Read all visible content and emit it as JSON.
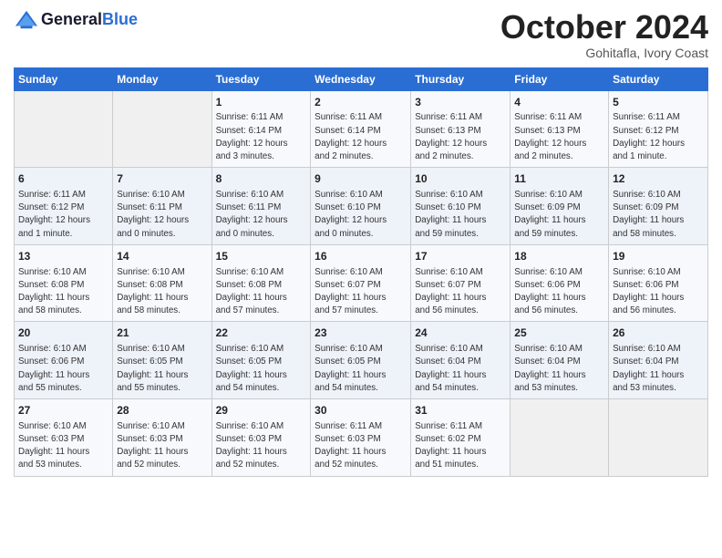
{
  "header": {
    "logo_general": "General",
    "logo_blue": "Blue",
    "month_title": "October 2024",
    "location": "Gohitafla, Ivory Coast"
  },
  "days_of_week": [
    "Sunday",
    "Monday",
    "Tuesday",
    "Wednesday",
    "Thursday",
    "Friday",
    "Saturday"
  ],
  "weeks": [
    [
      {
        "day": "",
        "info": ""
      },
      {
        "day": "",
        "info": ""
      },
      {
        "day": "1",
        "info": "Sunrise: 6:11 AM\nSunset: 6:14 PM\nDaylight: 12 hours\nand 3 minutes."
      },
      {
        "day": "2",
        "info": "Sunrise: 6:11 AM\nSunset: 6:14 PM\nDaylight: 12 hours\nand 2 minutes."
      },
      {
        "day": "3",
        "info": "Sunrise: 6:11 AM\nSunset: 6:13 PM\nDaylight: 12 hours\nand 2 minutes."
      },
      {
        "day": "4",
        "info": "Sunrise: 6:11 AM\nSunset: 6:13 PM\nDaylight: 12 hours\nand 2 minutes."
      },
      {
        "day": "5",
        "info": "Sunrise: 6:11 AM\nSunset: 6:12 PM\nDaylight: 12 hours\nand 1 minute."
      }
    ],
    [
      {
        "day": "6",
        "info": "Sunrise: 6:11 AM\nSunset: 6:12 PM\nDaylight: 12 hours\nand 1 minute."
      },
      {
        "day": "7",
        "info": "Sunrise: 6:10 AM\nSunset: 6:11 PM\nDaylight: 12 hours\nand 0 minutes."
      },
      {
        "day": "8",
        "info": "Sunrise: 6:10 AM\nSunset: 6:11 PM\nDaylight: 12 hours\nand 0 minutes."
      },
      {
        "day": "9",
        "info": "Sunrise: 6:10 AM\nSunset: 6:10 PM\nDaylight: 12 hours\nand 0 minutes."
      },
      {
        "day": "10",
        "info": "Sunrise: 6:10 AM\nSunset: 6:10 PM\nDaylight: 11 hours\nand 59 minutes."
      },
      {
        "day": "11",
        "info": "Sunrise: 6:10 AM\nSunset: 6:09 PM\nDaylight: 11 hours\nand 59 minutes."
      },
      {
        "day": "12",
        "info": "Sunrise: 6:10 AM\nSunset: 6:09 PM\nDaylight: 11 hours\nand 58 minutes."
      }
    ],
    [
      {
        "day": "13",
        "info": "Sunrise: 6:10 AM\nSunset: 6:08 PM\nDaylight: 11 hours\nand 58 minutes."
      },
      {
        "day": "14",
        "info": "Sunrise: 6:10 AM\nSunset: 6:08 PM\nDaylight: 11 hours\nand 58 minutes."
      },
      {
        "day": "15",
        "info": "Sunrise: 6:10 AM\nSunset: 6:08 PM\nDaylight: 11 hours\nand 57 minutes."
      },
      {
        "day": "16",
        "info": "Sunrise: 6:10 AM\nSunset: 6:07 PM\nDaylight: 11 hours\nand 57 minutes."
      },
      {
        "day": "17",
        "info": "Sunrise: 6:10 AM\nSunset: 6:07 PM\nDaylight: 11 hours\nand 56 minutes."
      },
      {
        "day": "18",
        "info": "Sunrise: 6:10 AM\nSunset: 6:06 PM\nDaylight: 11 hours\nand 56 minutes."
      },
      {
        "day": "19",
        "info": "Sunrise: 6:10 AM\nSunset: 6:06 PM\nDaylight: 11 hours\nand 56 minutes."
      }
    ],
    [
      {
        "day": "20",
        "info": "Sunrise: 6:10 AM\nSunset: 6:06 PM\nDaylight: 11 hours\nand 55 minutes."
      },
      {
        "day": "21",
        "info": "Sunrise: 6:10 AM\nSunset: 6:05 PM\nDaylight: 11 hours\nand 55 minutes."
      },
      {
        "day": "22",
        "info": "Sunrise: 6:10 AM\nSunset: 6:05 PM\nDaylight: 11 hours\nand 54 minutes."
      },
      {
        "day": "23",
        "info": "Sunrise: 6:10 AM\nSunset: 6:05 PM\nDaylight: 11 hours\nand 54 minutes."
      },
      {
        "day": "24",
        "info": "Sunrise: 6:10 AM\nSunset: 6:04 PM\nDaylight: 11 hours\nand 54 minutes."
      },
      {
        "day": "25",
        "info": "Sunrise: 6:10 AM\nSunset: 6:04 PM\nDaylight: 11 hours\nand 53 minutes."
      },
      {
        "day": "26",
        "info": "Sunrise: 6:10 AM\nSunset: 6:04 PM\nDaylight: 11 hours\nand 53 minutes."
      }
    ],
    [
      {
        "day": "27",
        "info": "Sunrise: 6:10 AM\nSunset: 6:03 PM\nDaylight: 11 hours\nand 53 minutes."
      },
      {
        "day": "28",
        "info": "Sunrise: 6:10 AM\nSunset: 6:03 PM\nDaylight: 11 hours\nand 52 minutes."
      },
      {
        "day": "29",
        "info": "Sunrise: 6:10 AM\nSunset: 6:03 PM\nDaylight: 11 hours\nand 52 minutes."
      },
      {
        "day": "30",
        "info": "Sunrise: 6:11 AM\nSunset: 6:03 PM\nDaylight: 11 hours\nand 52 minutes."
      },
      {
        "day": "31",
        "info": "Sunrise: 6:11 AM\nSunset: 6:02 PM\nDaylight: 11 hours\nand 51 minutes."
      },
      {
        "day": "",
        "info": ""
      },
      {
        "day": "",
        "info": ""
      }
    ]
  ]
}
